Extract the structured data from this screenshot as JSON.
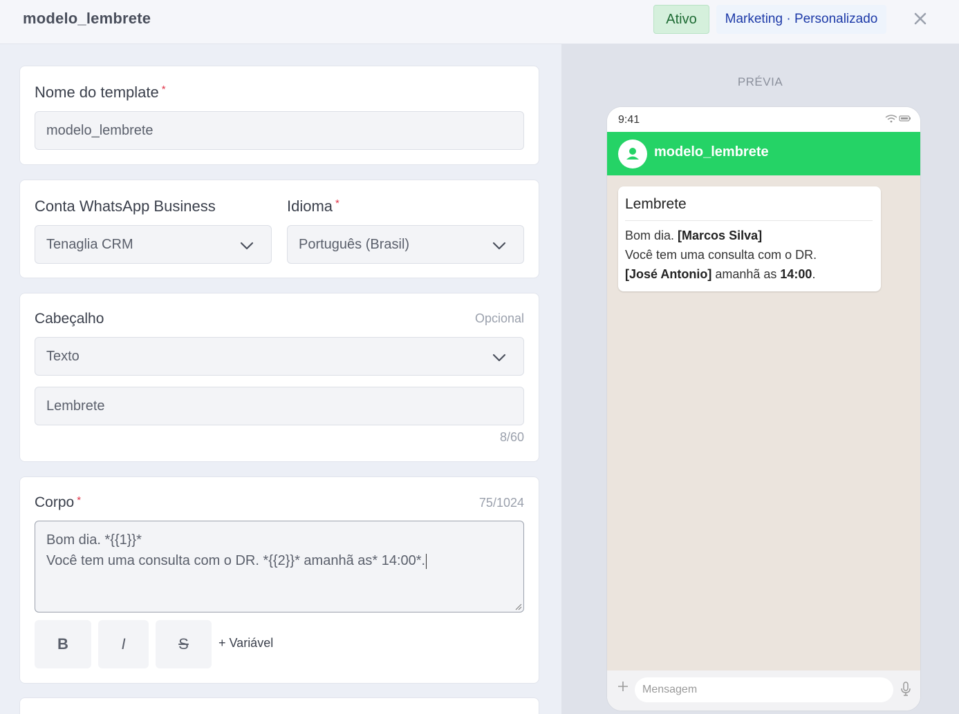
{
  "header": {
    "title": "modelo_lembrete",
    "status_badge": "Ativo",
    "category_badge": "Marketing · Personalizado",
    "close_icon": "close-icon"
  },
  "form": {
    "template_name": {
      "label": "Nome do template",
      "required_mark": "*",
      "value": "modelo_lembrete"
    },
    "account": {
      "label": "Conta WhatsApp Business",
      "value": "Tenaglia CRM",
      "icon": "chevron-down-icon"
    },
    "language": {
      "label": "Idioma",
      "required_mark": "*",
      "value": "Português (Brasil)",
      "icon": "chevron-down-icon"
    },
    "header_section": {
      "label": "Cabeçalho",
      "optional": "Opcional",
      "type_value": "Texto",
      "text_value": "Lembrete",
      "counter": "8/60"
    },
    "body": {
      "label": "Corpo",
      "required_mark": "*",
      "counter": "75/1024",
      "line1": "Bom dia. *{{1}}*",
      "line2": "Você tem uma consulta com o DR. *{{2}}* amanhã as* 14:00*.",
      "bold_label": "B",
      "italic_label": "I",
      "strike_label": "S",
      "variable_label": "+ Variável"
    }
  },
  "preview": {
    "label": "PRÉVIA",
    "status_time": "9:41",
    "contact_name": "modelo_lembrete",
    "bubble": {
      "title": "Lembrete",
      "line1_prefix": "Bom dia. ",
      "line1_var": "[Marcos Silva]",
      "line2": "Você tem uma consulta com o DR.",
      "line3_var": "[José Antonio]",
      "line3_mid": " amanhã as ",
      "line3_time": "14:00",
      "line3_end": "."
    },
    "input_placeholder": "Mensagem"
  },
  "colors": {
    "whatsapp_green": "#25d366",
    "active_badge_bg": "#d5f0dc",
    "required": "#e0364a",
    "chat_bg": "#ebe4dd"
  }
}
